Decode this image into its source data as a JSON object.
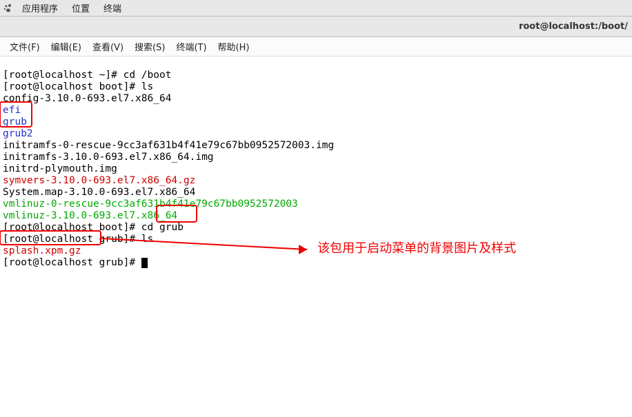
{
  "topbar": {
    "apps": "应用程序",
    "locations": "位置",
    "terminal": "终端"
  },
  "window": {
    "title": "root@localhost:/boot/"
  },
  "menubar": {
    "file": "文件(F)",
    "edit": "编辑(E)",
    "view": "查看(V)",
    "search": "搜索(S)",
    "terminal": "终端(T)",
    "help": "帮助(H)"
  },
  "term": {
    "l1a": "[root@localhost ~]# ",
    "l1b": "cd /boot",
    "l2a": "[root@localhost boot]# ",
    "l2b": "ls",
    "l3": "config-3.10.0-693.el7.x86_64",
    "l4": "efi",
    "l5": "grub",
    "l6": "grub2",
    "l7": "initramfs-0-rescue-9cc3af631b4f41e79c67bb0952572003.img",
    "l8": "initramfs-3.10.0-693.el7.x86_64.img",
    "l9": "initrd-plymouth.img",
    "l10": "symvers-3.10.0-693.el7.x86_64.gz",
    "l11": "System.map-3.10.0-693.el7.x86_64",
    "l12": "vmlinuz-0-rescue-9cc3af631b4f41e79c67bb0952572003",
    "l13": "vmlinuz-3.10.0-693.el7.x86_64",
    "l14a": "[root@localhost boot]# ",
    "l14b": "cd ",
    "l14c": "grub",
    "l15a": "[root@localhost grub]# ",
    "l15b": "ls",
    "l16": "splash.xpm.gz",
    "l17a": "[root@localhost grub]# "
  },
  "annotation": "该包用于启动菜单的背景图片及样式"
}
